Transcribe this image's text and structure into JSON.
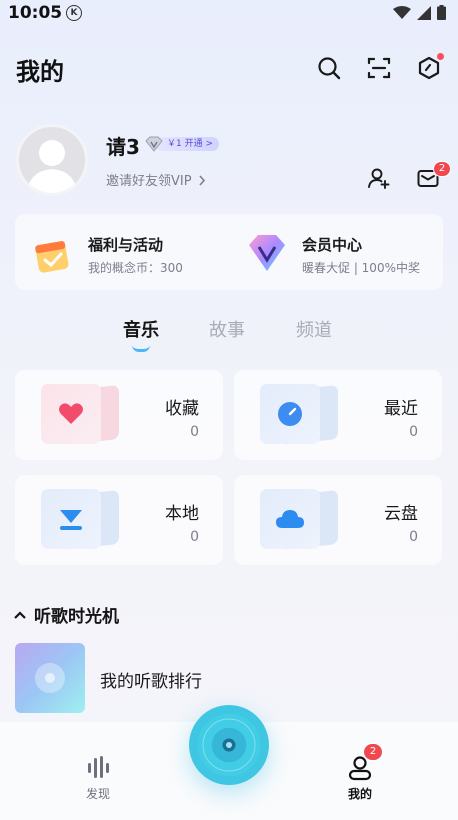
{
  "status": {
    "time": "10:05",
    "k_badge": "K"
  },
  "header": {
    "title": "我的"
  },
  "profile": {
    "username": "请3",
    "vip_text": "￥1 开通 >",
    "invite_text": "邀请好友领VIP",
    "mail_badge": "2"
  },
  "promo": {
    "left": {
      "title": "福利与活动",
      "subtitle": "我的概念币：300"
    },
    "right": {
      "title": "会员中心",
      "subtitle": "暖春大促 | 100%中奖"
    }
  },
  "tabs": [
    "音乐",
    "故事",
    "频道"
  ],
  "grid": [
    {
      "title": "收藏",
      "count": "0"
    },
    {
      "title": "最近",
      "count": "0"
    },
    {
      "title": "本地",
      "count": "0"
    },
    {
      "title": "云盘",
      "count": "0"
    }
  ],
  "section": {
    "title": "听歌时光机",
    "item_title": "我的听歌排行"
  },
  "bottom_nav": {
    "discover": "发现",
    "mine": "我的",
    "mine_badge": "2"
  },
  "colors": {
    "accent": "#49b8f7",
    "badge_red": "#f0484f"
  }
}
